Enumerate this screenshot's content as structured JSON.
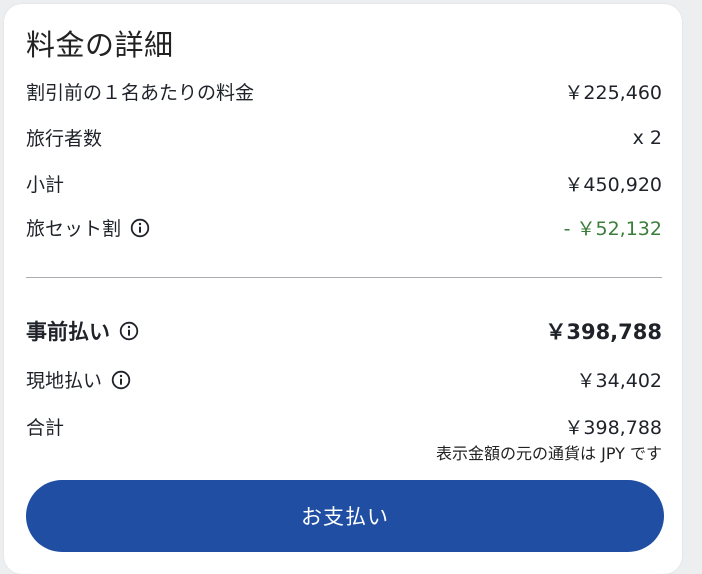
{
  "title": "料金の詳細",
  "rows": {
    "price_per_person": {
      "label": "割引前の１名あたりの料金",
      "value": "￥225,460"
    },
    "travelers": {
      "label": "旅行者数",
      "value": "x 2"
    },
    "subtotal": {
      "label": "小計",
      "value": "￥450,920"
    },
    "bundle_discount": {
      "label": "旅セット割",
      "value": "- ￥52,132"
    },
    "prepay": {
      "label": "事前払い",
      "value": "￥398,788"
    },
    "pay_at_property": {
      "label": "現地払い",
      "value": "￥34,402"
    },
    "total": {
      "label": "合計",
      "value": "￥398,788"
    }
  },
  "currency_note": "表示金額の元の通貨は JPY です",
  "pay_button": {
    "label": "お支払い"
  },
  "colors": {
    "accent": "#1f4ea3",
    "discount": "#3b7d3b",
    "background": "#eceef0"
  },
  "icons": {
    "info": "info-icon"
  }
}
